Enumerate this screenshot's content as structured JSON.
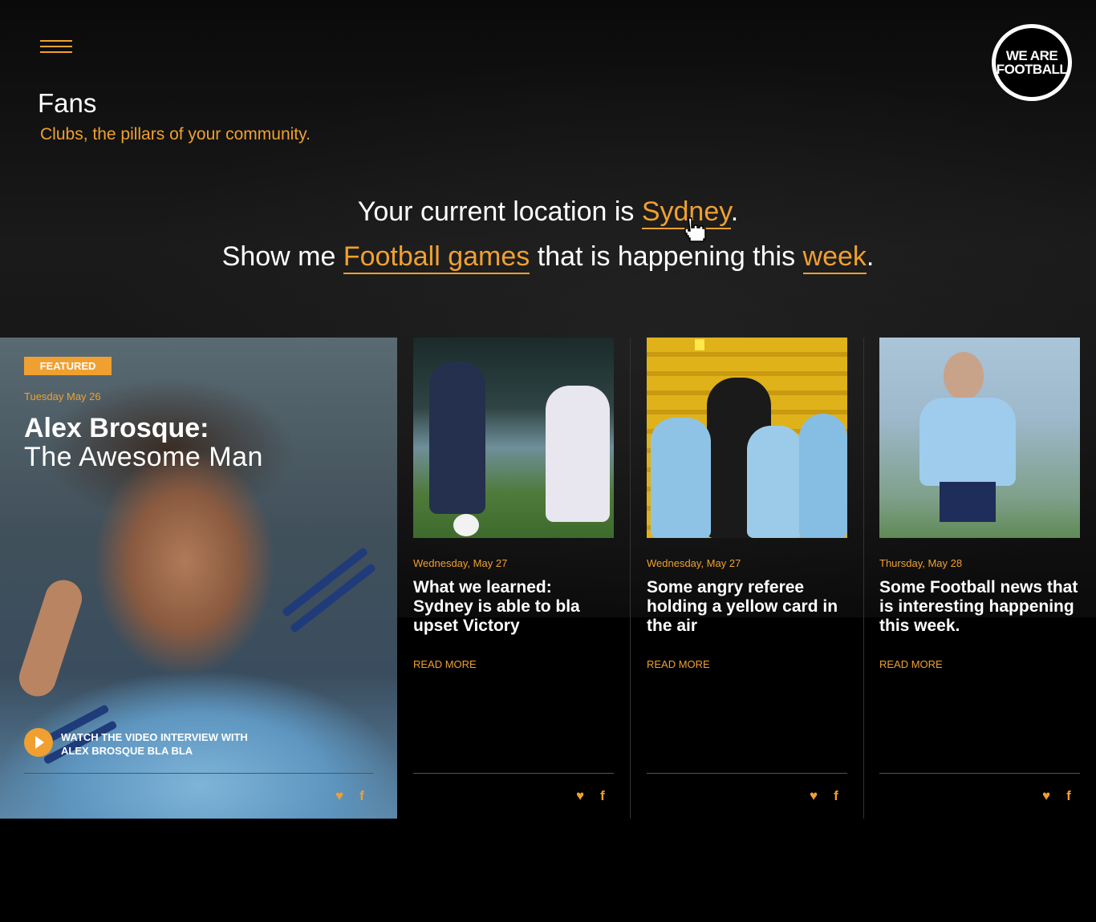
{
  "header": {
    "menu_icon": "hamburger-icon",
    "logo_line1": "WE ARE",
    "logo_line2": "FOOTBALL"
  },
  "page": {
    "title": "Fans",
    "subtitle": "Clubs, the pillars of your community."
  },
  "filter": {
    "line1_prefix": "Your current location is ",
    "location": "Sydney",
    "line1_suffix": ".",
    "line2_prefix": "Show me ",
    "category": "Football games",
    "line2_middle": " that is happening this ",
    "period": "week",
    "line2_suffix": "."
  },
  "featured": {
    "badge": "FEATURED",
    "date": "Tuesday May 26",
    "title_bold": "Alex Brosque:",
    "title_light": "The Awesome Man",
    "video_text": "WATCH THE VIDEO INTERVIEW WITH ALEX BROSQUE BLA BLA",
    "play_icon": "play-icon"
  },
  "cards": [
    {
      "date": "Wednesday, May 27",
      "title": "What we learned: Sydney is able to bla upset Victory",
      "read_more": "READ MORE"
    },
    {
      "date": "Wednesday, May 27",
      "title": "Some angry referee holding a yellow card in the air",
      "read_more": "READ MORE"
    },
    {
      "date": "Thursday, May 28",
      "title": "Some Football news that is interesting happening this week.",
      "read_more": "READ MORE"
    }
  ],
  "social": {
    "twitter": "twitter-icon",
    "facebook": "facebook-icon"
  },
  "colors": {
    "accent": "#f0a030",
    "background": "#000000"
  }
}
